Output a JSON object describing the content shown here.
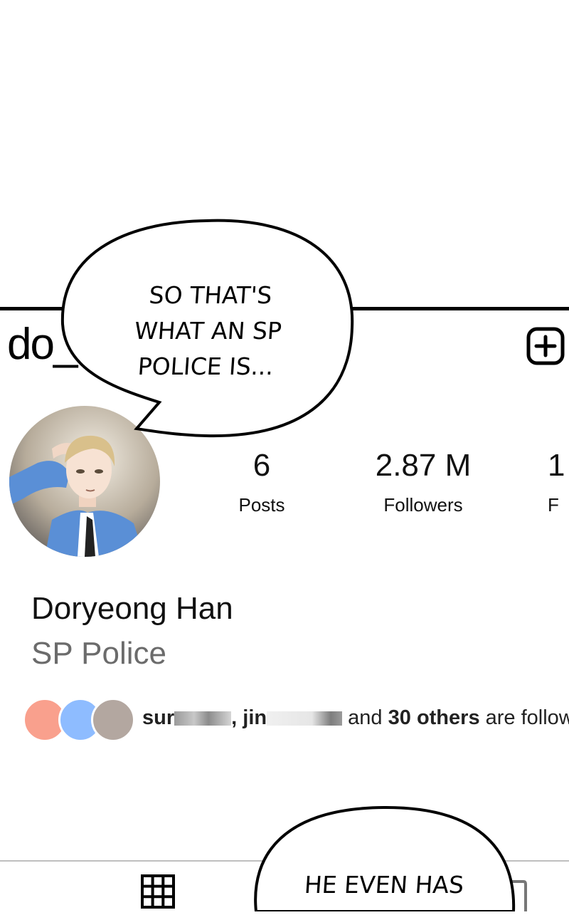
{
  "profile": {
    "username": "do_",
    "full_name": "Doryeong Han",
    "category": "SP Police",
    "avatar_icon": "avatar-illustration"
  },
  "stats": {
    "posts_value": "6",
    "posts_label": "Posts",
    "followers_value": "2.87 M",
    "followers_label": "Followers",
    "following_value": "1",
    "following_label": "F"
  },
  "followed_by": {
    "name1": "sur",
    "separator": ", ",
    "name2": "jin",
    "and_text": "and ",
    "count": "30 others",
    "suffix": " are follow",
    "dot_colors": [
      "#f9a08d",
      "#8ebcff",
      "#b3a7a0"
    ]
  },
  "speech": {
    "bubble1_line1": "SO THAT'S",
    "bubble1_line2": "WHAT AN SP",
    "bubble1_line3": "POLICE IS...",
    "bubble2_line1": "HE EVEN HAS"
  },
  "icons": {
    "new_post": "plus-square-icon",
    "grid": "grid-icon",
    "tagged": "tagged-icon"
  }
}
